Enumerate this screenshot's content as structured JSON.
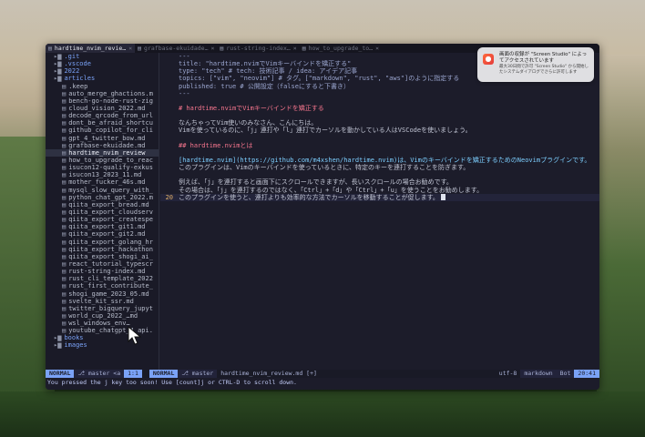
{
  "tabs": [
    {
      "label": "hardtime_nvim_revie…",
      "active": true
    },
    {
      "label": "grafbase-ekuidade…",
      "active": false
    },
    {
      "label": "rust-string-index…",
      "active": false
    },
    {
      "label": "how_to_upgrade_to…",
      "active": false
    }
  ],
  "tree": [
    {
      "label": ".git",
      "type": "dir",
      "indent": 1
    },
    {
      "label": ".vscode",
      "type": "dir",
      "indent": 1
    },
    {
      "label": "2022",
      "type": "dir",
      "indent": 1
    },
    {
      "label": "articles",
      "type": "dir",
      "indent": 1
    },
    {
      "label": ".keep",
      "type": "file",
      "indent": 2
    },
    {
      "label": "auto_merge_ghactions.m",
      "type": "file",
      "indent": 2
    },
    {
      "label": "bench-go-node-rust-zig",
      "type": "file",
      "indent": 2
    },
    {
      "label": "cloud_vision_2022.md",
      "type": "file",
      "indent": 2
    },
    {
      "label": "decode_qrcode_from_url",
      "type": "file",
      "indent": 2
    },
    {
      "label": "dont_be_afraid_shortcu",
      "type": "file",
      "indent": 2
    },
    {
      "label": "github_copilot_for_cli",
      "type": "file",
      "indent": 2
    },
    {
      "label": "gpt_4_twitter_bow.md",
      "type": "file",
      "indent": 2
    },
    {
      "label": "grafbase-ekuidade.md",
      "type": "file",
      "indent": 2
    },
    {
      "label": "hardtime_nvim_review",
      "type": "file",
      "indent": 2,
      "selected": true
    },
    {
      "label": "how_to_upgrade_to_reac",
      "type": "file",
      "indent": 2
    },
    {
      "label": "isucon12-qualify-exkus",
      "type": "file",
      "indent": 2
    },
    {
      "label": "isucon13_2023_11.md",
      "type": "file",
      "indent": 2
    },
    {
      "label": "mother_fucker_46s.md",
      "type": "file",
      "indent": 2
    },
    {
      "label": "mysql_slow_query_with_",
      "type": "file",
      "indent": 2
    },
    {
      "label": "python_chat_gpt_2022.m",
      "type": "file",
      "indent": 2
    },
    {
      "label": "qiita_export_bread.md",
      "type": "file",
      "indent": 2
    },
    {
      "label": "qiita_export_cloudserv",
      "type": "file",
      "indent": 2
    },
    {
      "label": "qiita_export_createspe",
      "type": "file",
      "indent": 2
    },
    {
      "label": "qiita_export_git1.md",
      "type": "file",
      "indent": 2
    },
    {
      "label": "qiita_export_git2.md",
      "type": "file",
      "indent": 2
    },
    {
      "label": "qiita_export_golang_hr",
      "type": "file",
      "indent": 2
    },
    {
      "label": "qiita_export_hackathon",
      "type": "file",
      "indent": 2
    },
    {
      "label": "qiita_export_shogi_ai_",
      "type": "file",
      "indent": 2
    },
    {
      "label": "react_tutorial_typescr",
      "type": "file",
      "indent": 2
    },
    {
      "label": "rust-string-index.md",
      "type": "file",
      "indent": 2
    },
    {
      "label": "rust_cli_template_2022",
      "type": "file",
      "indent": 2
    },
    {
      "label": "rust_first_contribute_",
      "type": "file",
      "indent": 2
    },
    {
      "label": "shogi_game_2023_05.md",
      "type": "file",
      "indent": 2
    },
    {
      "label": "svelte_kit_ssr.md",
      "type": "file",
      "indent": 2
    },
    {
      "label": "twitter_bigquery_jupyt",
      "type": "file",
      "indent": 2
    },
    {
      "label": "world_cup_2022_…md",
      "type": "file",
      "indent": 2
    },
    {
      "label": "wsl_windows_env…",
      "type": "file",
      "indent": 2
    },
    {
      "label": "youtube_chatgpt_4_api.",
      "type": "file",
      "indent": 2
    },
    {
      "label": "books",
      "type": "dir",
      "indent": 1
    },
    {
      "label": "images",
      "type": "dir",
      "indent": 1
    }
  ],
  "editor_lines": [
    {
      "n": "",
      "text": "---",
      "kind": "fm"
    },
    {
      "n": "",
      "text": "title: \"hardtime.nvimでVimキーバインドを矯正する\"",
      "kind": "fm"
    },
    {
      "n": "",
      "text": "type: \"tech\" # tech: 技術記事 / idea: アイデア記事",
      "kind": "fm"
    },
    {
      "n": "",
      "text": "topics: [\"vim\", \"neovim\"] # タグ。[\"markdown\", \"rust\", \"aws\"]のように指定する",
      "kind": "fm"
    },
    {
      "n": "",
      "text": "published: true # 公開設定（falseにすると下書き）",
      "kind": "fm"
    },
    {
      "n": "",
      "text": "---",
      "kind": "fm"
    },
    {
      "n": "",
      "text": "",
      "kind": "txt"
    },
    {
      "n": "",
      "text": "# hardtime.nvimでVimキーバインドを矯正する",
      "kind": "h"
    },
    {
      "n": "",
      "text": "",
      "kind": "txt"
    },
    {
      "n": "",
      "text": "なんちゃってVim使いのみなさん、こんにちは。",
      "kind": "txt"
    },
    {
      "n": "",
      "text": "Vimを使っているのに、「j」連打や「l」連打でカーソルを動かしている人はVSCodeを使いましょう。",
      "kind": "txt"
    },
    {
      "n": "",
      "text": "",
      "kind": "txt"
    },
    {
      "n": "",
      "text": "## hardtime.nvimとは",
      "kind": "h"
    },
    {
      "n": "",
      "text": "",
      "kind": "txt"
    },
    {
      "n": "",
      "text": "[hardtime.nvim](https://github.com/m4xshen/hardtime.nvim)は、Vimのキーバインドを矯正するためのNeovimプラグインです。",
      "kind": "link"
    },
    {
      "n": "",
      "text": "このプラグインは、Vimのキーバインドを使っているときに、特定のキーを連打することを防ぎます。",
      "kind": "txt"
    },
    {
      "n": "",
      "text": "",
      "kind": "txt"
    },
    {
      "n": "",
      "text": "例えば、「j」を連打すると画面下にスクロールできますが、長いスクロールの場合お勧めです。",
      "kind": "txt"
    },
    {
      "n": "",
      "text": "その場合は、「j」を連打するのではなく、「Ctrl」+「d」や「Ctrl」+「u」を使うことをお勧めします。",
      "kind": "txt"
    },
    {
      "n": "20",
      "text": "このプラグインを使うと、連打よりも効率的な方法でカーソルを移動することが促します。",
      "kind": "cur"
    }
  ],
  "status": {
    "left_mode": "NORMAL",
    "left_branch": "master",
    "left_branch_extra": "<a",
    "left_pos": "1:1",
    "right_mode": "NORMAL",
    "right_branch": "master",
    "filename": "hardtime_nvim_review.md [+]",
    "encoding": "utf-8",
    "filetype": "markdown",
    "scroll": "Bot",
    "position": "20:41"
  },
  "cmdline": "You pressed the j key too soon! Use [count]j or CTRL-D to scroll down.",
  "notification": {
    "title": "画面の収録が \"Screen Studio\" によってアクセスされています",
    "body": "最大30日間で許可 \"Screen Studio\" から開始したシステムダイアログでさらに許可します"
  },
  "icons": {
    "folder": "folder-icon",
    "file": "file-icon",
    "branch": "git-branch-icon",
    "app": "screen-studio-icon",
    "pointer": "mouse-pointer-icon"
  },
  "colors": {
    "accent": "#7aa2f7",
    "heading": "#f7768e",
    "link": "#7dcfff",
    "bg": "#1c1c2a"
  }
}
